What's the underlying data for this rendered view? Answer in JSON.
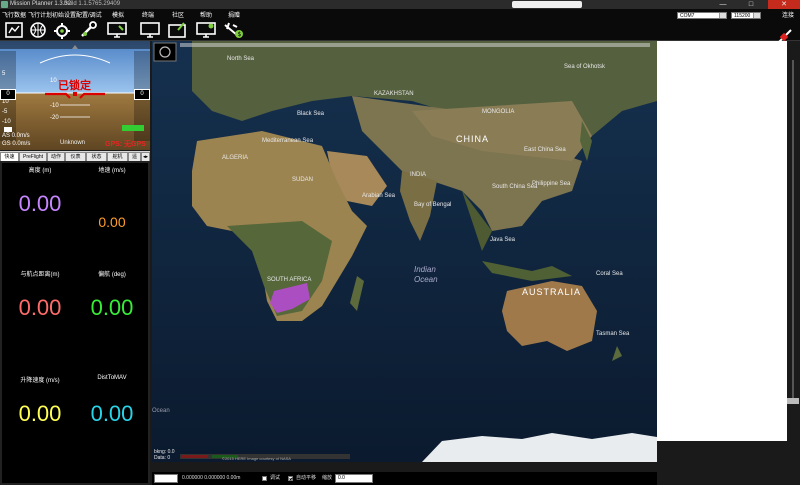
{
  "window": {
    "title": "Mission Planner 1.3.32",
    "version_box": "build 1.1.5765.29409",
    "minimize": "—",
    "maximize": "□",
    "close": "✕"
  },
  "menu": {
    "items": [
      "飞行数据",
      "飞行计划",
      "初始设置",
      "配置/调试",
      "模拟",
      "终端",
      "社区",
      "帮助",
      "捐赠"
    ],
    "icons": [
      "flight-data-icon",
      "flight-plan-icon",
      "initial-setup-icon",
      "config-tuning-icon",
      "simulation-icon",
      "terminal-icon",
      "community-icon",
      "help-icon",
      "donate-icon"
    ]
  },
  "connection": {
    "port": "COM7",
    "baud": "115200",
    "connect_label": "连接"
  },
  "hud": {
    "armed_text": "已锁定",
    "gps_text": "GPS: 无GPS",
    "left_scale": "0",
    "right_scale": "0",
    "ticks_left": [
      "10",
      "5",
      "-5",
      "-10"
    ],
    "pitch_ticks": [
      "10",
      "-10",
      "-20"
    ],
    "airspeed_label": "AS 0.0m/s",
    "groundspeed_label": "GS 0.0m/s",
    "mode_label": "Unknown",
    "colors": {
      "sky": "#6fa0d8",
      "ground": "#8a6a3a",
      "armed": "#dd0000",
      "gps": "#dd2222"
    }
  },
  "tabs": [
    "快速",
    "PreFlight",
    "动作",
    "仪表",
    "状态",
    "舵机",
    "遥"
  ],
  "quick": {
    "fields": [
      {
        "label": "高度 (m)",
        "value": "0.00",
        "color": "#c686ff"
      },
      {
        "label": "地速 (m/s)",
        "value": "0.00",
        "color": "#ff9c2a"
      },
      {
        "label": "与航点距离(m)",
        "value": "0.00",
        "color": "#ff6b6b"
      },
      {
        "label": "偏航 (deg)",
        "value": "0.00",
        "color": "#37ee37"
      },
      {
        "label": "升降速度 (m/s)",
        "value": "0.00",
        "color": "#ffff55"
      },
      {
        "label": "DistToMAV",
        "value": "0.00",
        "color": "#29d4e8"
      }
    ]
  },
  "map": {
    "labels": {
      "china": "CHINA",
      "india": "INDIA",
      "australia": "AUSTRALIA",
      "kazakhstan": "KAZAKHSTAN",
      "algeria": "ALGERIA",
      "sudan": "SUDAN",
      "indian_ocean_1": "Indian",
      "indian_ocean_2": "Ocean",
      "mediterranean": "Mediterranean Sea",
      "arabian_sea": "Arabian Sea",
      "bay_of_bengal": "Bay of Bengal",
      "south_china_sea": "South China Sea",
      "philippine_sea": "Philippine Sea",
      "coral_sea": "Coral Sea",
      "tasman_sea": "Tasman Sea",
      "black_sea": "Black Sea",
      "sea_of_okhotsk": "Sea of Okhotsk",
      "north_sea": "North Sea",
      "java_sea": "Java Sea",
      "east_china_sea": "East China Sea",
      "mongolia": "MONGOLIA",
      "south_africa": "SOUTH AFRICA",
      "ocean_bottom": "Ocean"
    },
    "telemetry_lines": [
      "bkng: 0.0",
      "Data: 0"
    ],
    "copyright": "©2015 HERE   Image courtesy of NASA"
  },
  "statusbar": {
    "coords": "0.000000  0.000000   0.00m",
    "debug_label": "调试",
    "autopan_label": "自动平移",
    "zoom_label": "缩放",
    "zoom_value": "0.0"
  }
}
